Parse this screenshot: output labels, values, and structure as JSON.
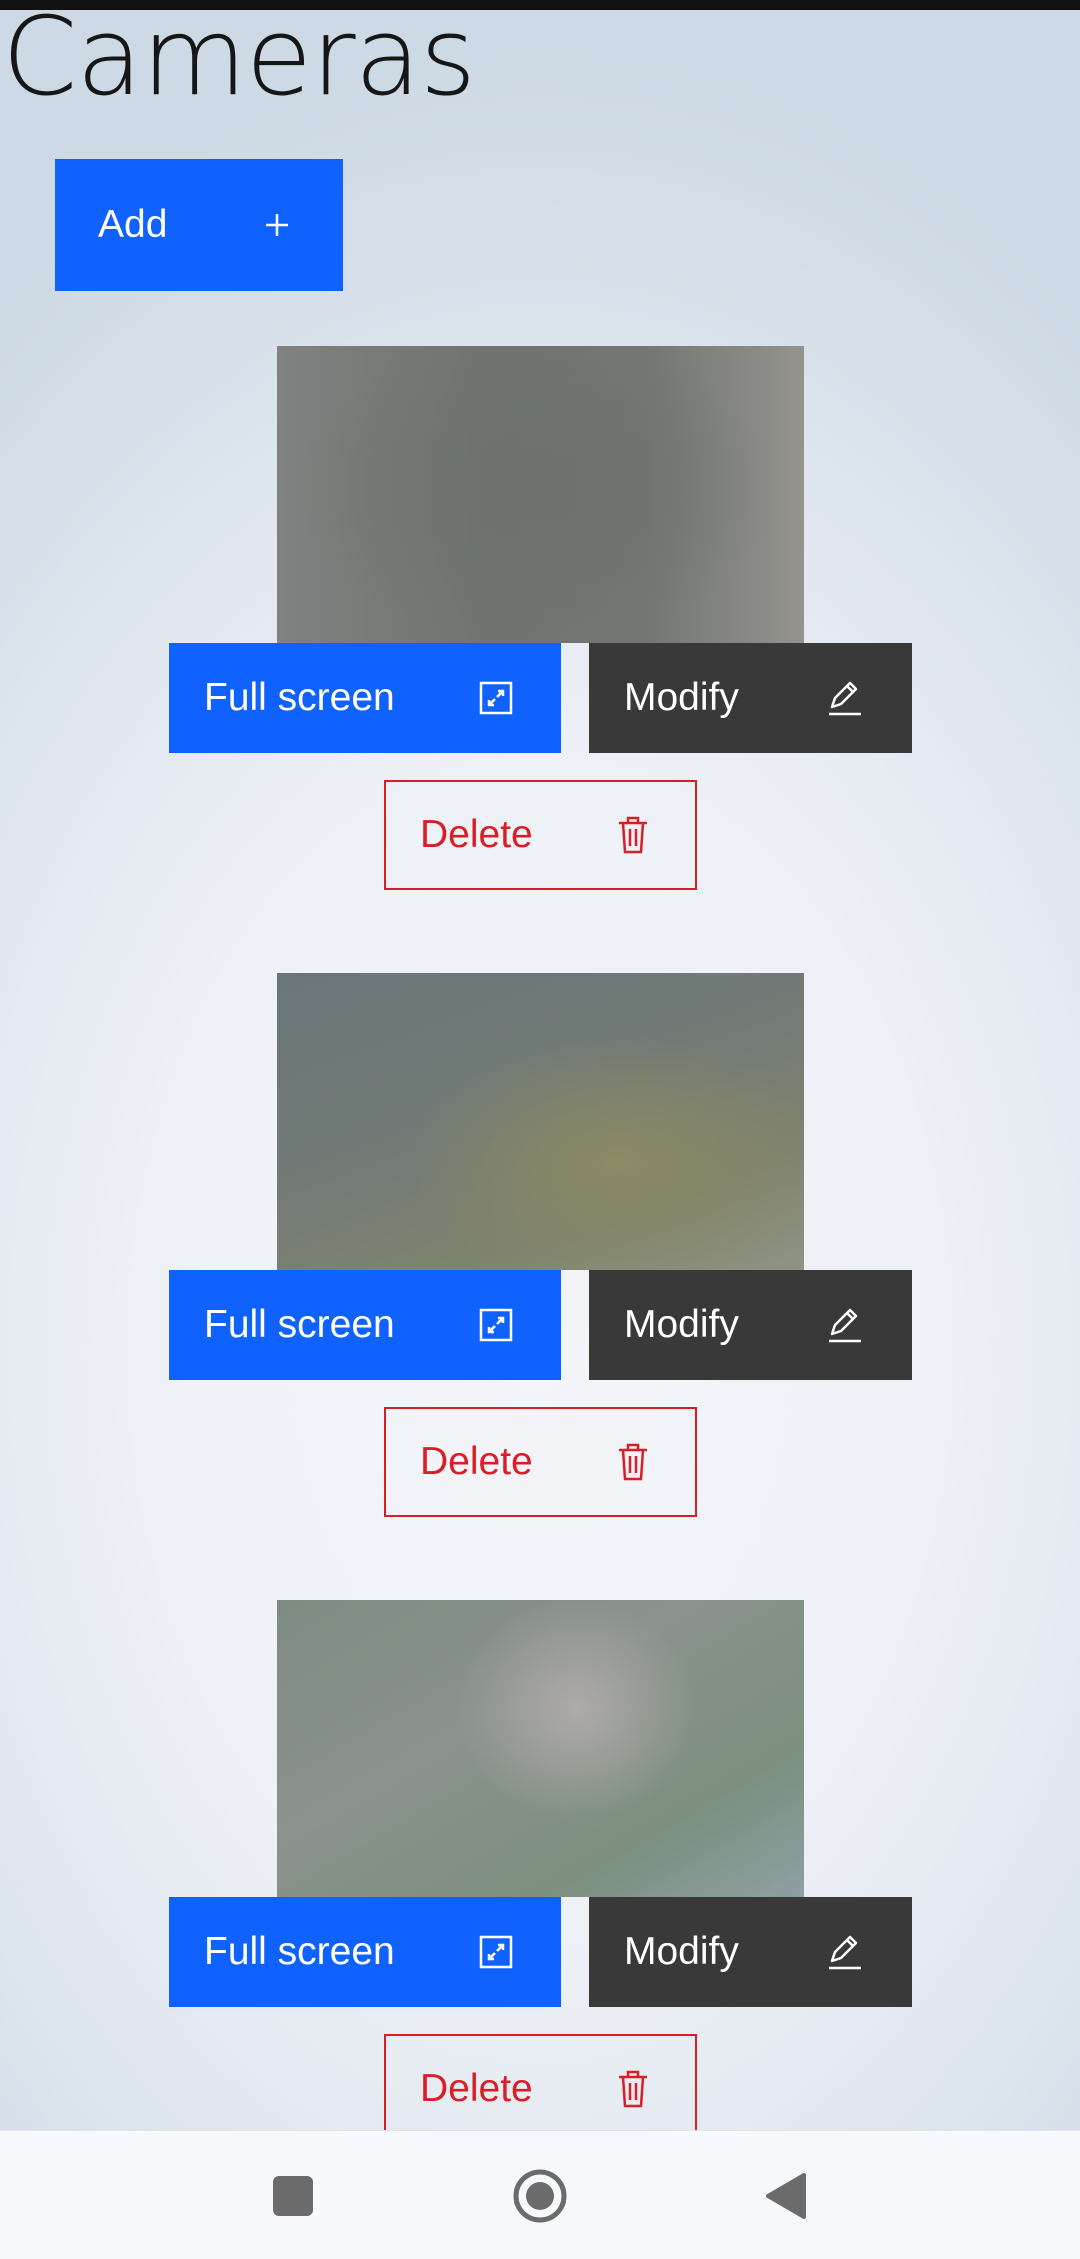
{
  "page": {
    "title": "Cameras"
  },
  "toolbar": {
    "add_label": "Add",
    "add_icon": "plus-icon"
  },
  "cameras": [
    {
      "fullscreen_label": "Full screen",
      "modify_label": "Modify",
      "delete_label": "Delete"
    },
    {
      "fullscreen_label": "Full screen",
      "modify_label": "Modify",
      "delete_label": "Delete"
    },
    {
      "fullscreen_label": "Full screen",
      "modify_label": "Modify",
      "delete_label": "Delete"
    }
  ],
  "icons": {
    "fullscreen": "maximize-icon",
    "modify": "pencil-icon",
    "delete": "trash-icon"
  },
  "navbar": {
    "items": [
      "recents-square",
      "home-circle",
      "back-triangle"
    ]
  },
  "colors": {
    "primary": "#0f62fe",
    "secondary": "#393939",
    "danger": "#da1e28"
  }
}
